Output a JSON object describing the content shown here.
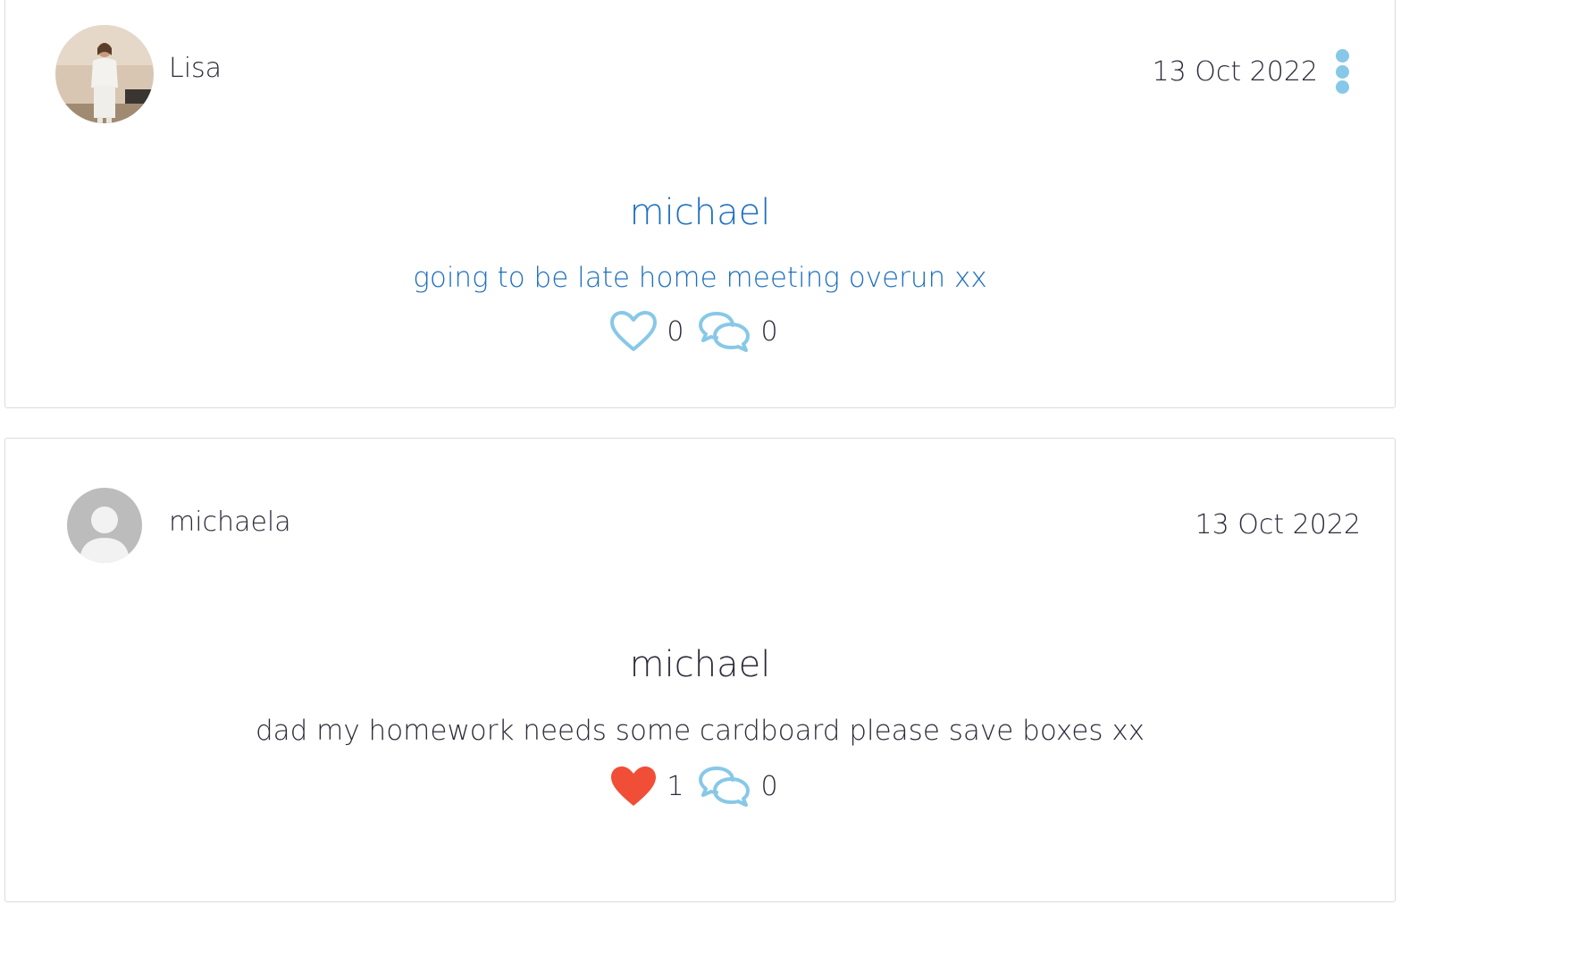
{
  "posts": [
    {
      "author": "Lisa",
      "date": "13 Oct 2022",
      "title": "michael",
      "body": "going to be late home meeting overun xx",
      "likes": "0",
      "comments": "0",
      "liked": false,
      "avatar": "user-photo",
      "has_menu": true
    },
    {
      "author": "michaela",
      "date": "13 Oct 2022",
      "title": "michael",
      "body": "dad my homework needs some cardboard please save boxes xx",
      "likes": "1",
      "comments": "0",
      "liked": true,
      "avatar": "default-avatar",
      "has_menu": false
    }
  ],
  "colors": {
    "accent_blue": "#1e6fbf",
    "icon_blue": "#87c8e8",
    "heart_red": "#f04e37",
    "text_dark": "#2b2b3a",
    "border": "#dcdcdc"
  },
  "icons": {
    "like": "heart-icon",
    "comment": "speech-bubbles-icon",
    "menu": "vertical-dots-icon",
    "avatar_placeholder": "user-silhouette-icon"
  }
}
